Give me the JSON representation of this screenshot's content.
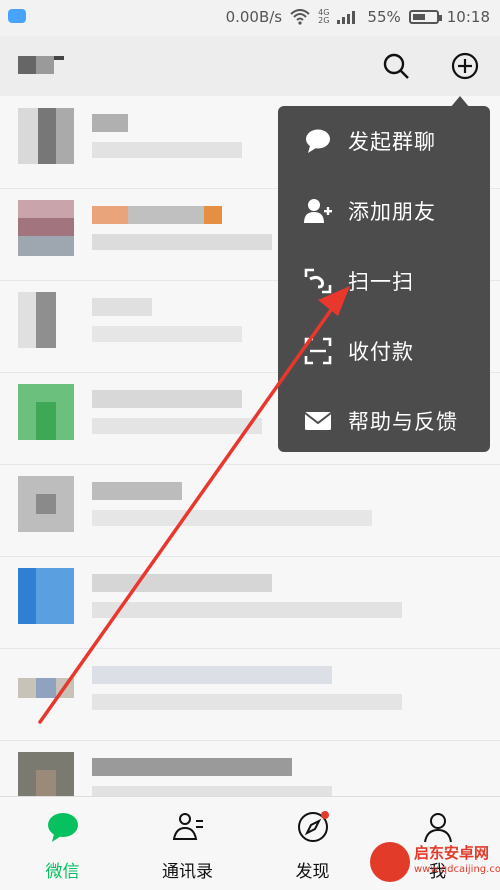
{
  "status_bar": {
    "network_speed": "0.00B/s",
    "net_4g": "4G",
    "net_2g": "2G",
    "battery_percent": "55%",
    "battery_level": 0.55,
    "time": "10:18"
  },
  "header": {
    "search_icon": "search-icon",
    "add_icon": "plus-circle-icon"
  },
  "popup_menu": {
    "items": [
      {
        "label": "发起群聊",
        "icon": "chat-bubble-icon"
      },
      {
        "label": "添加朋友",
        "icon": "add-friend-icon"
      },
      {
        "label": "扫一扫",
        "icon": "scan-icon"
      },
      {
        "label": "收付款",
        "icon": "payment-scan-icon"
      },
      {
        "label": "帮助与反馈",
        "icon": "mail-icon"
      }
    ]
  },
  "tab_bar": {
    "tabs": [
      {
        "label": "微信",
        "icon": "chat-icon",
        "active": true
      },
      {
        "label": "通讯录",
        "icon": "contacts-icon",
        "active": false
      },
      {
        "label": "发现",
        "icon": "compass-icon",
        "active": false
      },
      {
        "label": "我",
        "icon": "person-icon",
        "active": false
      }
    ]
  },
  "watermark": {
    "text": "启东安卓网",
    "url": "www.qdcaijing.com"
  },
  "colors": {
    "accent": "#07c160",
    "popup_bg": "#4c4c4c",
    "annotation_arrow": "#e8372c"
  }
}
